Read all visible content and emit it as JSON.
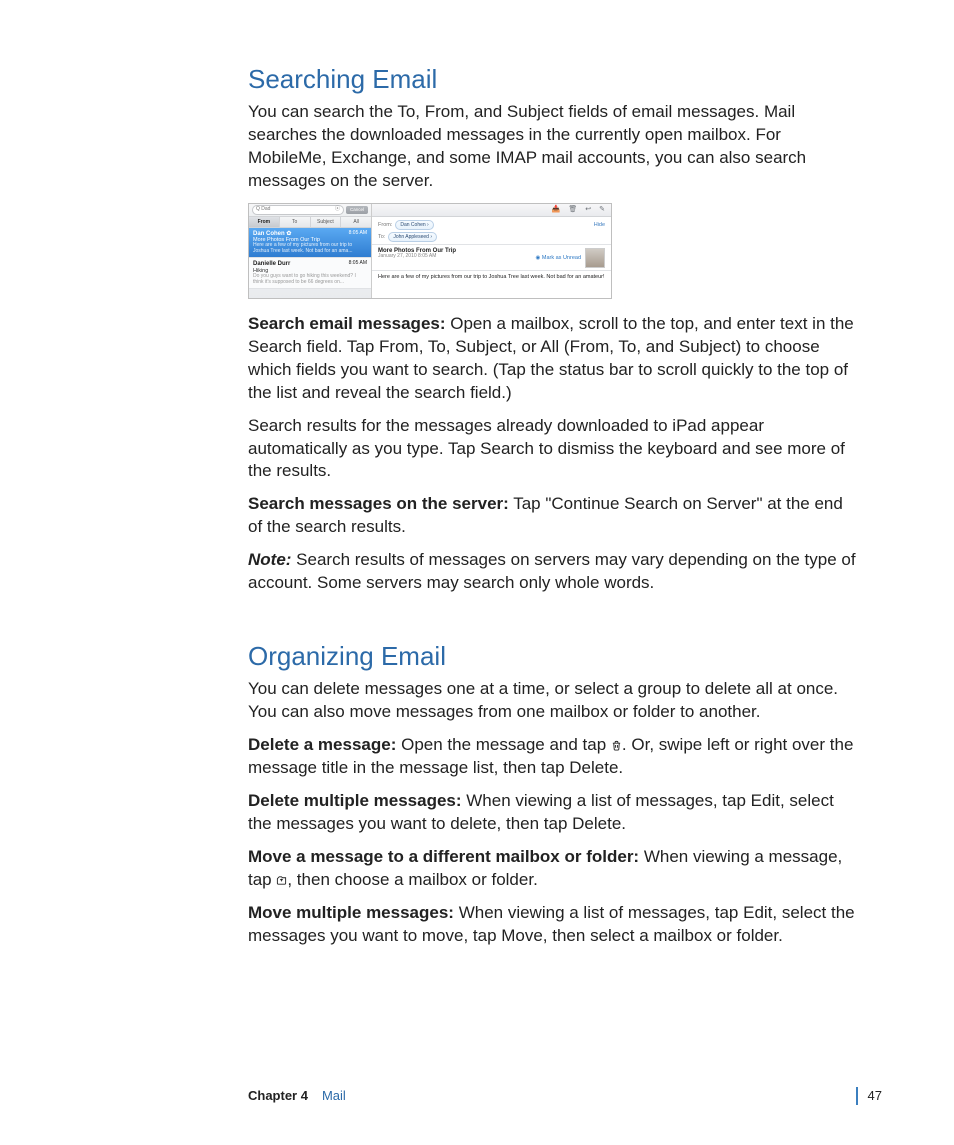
{
  "section1": {
    "heading": "Searching Email",
    "intro": "You can search the To, From, and Subject fields of email messages. Mail searches the downloaded messages in the currently open mailbox. For MobileMe, Exchange, and some IMAP mail accounts, you can also search messages on the server.",
    "p_searchEmail_label": "Search email messages:",
    "p_searchEmail_body": "  Open a mailbox, scroll to the top, and enter text in the Search field. Tap From, To, Subject, or All (From, To, and Subject) to choose which fields you want to search. (Tap the status bar to scroll quickly to the top of the list and reveal the search field.)",
    "p_results": "Search results for the messages already downloaded to iPad appear automatically as you type. Tap Search to dismiss the keyboard and see more of the results.",
    "p_server_label": "Search messages on the server:",
    "p_server_body": "  Tap \"Continue Search on Server\" at the end of the search results.",
    "note_label": "Note:",
    "note_body": "  Search results of messages on servers may vary depending on the type of account. Some servers may search only whole words."
  },
  "section2": {
    "heading": "Organizing Email",
    "intro": "You can delete messages one at a time, or select a group to delete all at once. You can also move messages from one mailbox or folder to another.",
    "p_del1_label": "Delete a message:",
    "p_del1_a": "  Open the message and tap ",
    "p_del1_b": ". Or, swipe left or right over the message title in the message list, then tap Delete.",
    "p_delmult_label": "Delete multiple messages:",
    "p_delmult_body": "  When viewing a list of messages, tap Edit, select the messages you want to delete, then tap Delete.",
    "p_move_label": "Move a message to a different mailbox or folder:",
    "p_move_a": "  When viewing a message, tap ",
    "p_move_b": ", then choose a mailbox or folder.",
    "p_movemult_label": "Move multiple messages:",
    "p_movemult_body": "  When viewing a list of messages, tap Edit, select the messages you want to move, tap Move, then select a mailbox or folder."
  },
  "mock": {
    "search_q": "Q  Dad",
    "search_clear": "ⓧ",
    "cancel": "Cancel",
    "segs": [
      "From",
      "To",
      "Subject",
      "All"
    ],
    "items": [
      {
        "name": "Dan Cohen ✿",
        "time": "8:05 AM",
        "subject": "More Photos From Our Trip",
        "preview": "Here are a few of my pictures from our trip to Joshua Tree last week. Not bad for an ama..."
      },
      {
        "name": "Danielle Durr",
        "time": "8:05 AM",
        "subject": "Hiking",
        "preview": "Do you guys want to go hiking this weekend? I think it's supposed to be 66 degrees on..."
      }
    ],
    "from_label": "From:",
    "from_chip": "Dan Cohen ›",
    "hide": "Hide",
    "to_label": "To:",
    "to_chip": "John Appleseed ›",
    "subj_title": "More Photos From Our Trip",
    "subj_date": "January 27, 2010 8:05 AM",
    "mark_unread": "◉ Mark as Unread",
    "body_preview": "Here are a few of my pictures from our trip to Joshua Tree last week. Not bad for an amateur!"
  },
  "footer": {
    "chapter": "Chapter 4",
    "name": "Mail",
    "page": "47"
  }
}
